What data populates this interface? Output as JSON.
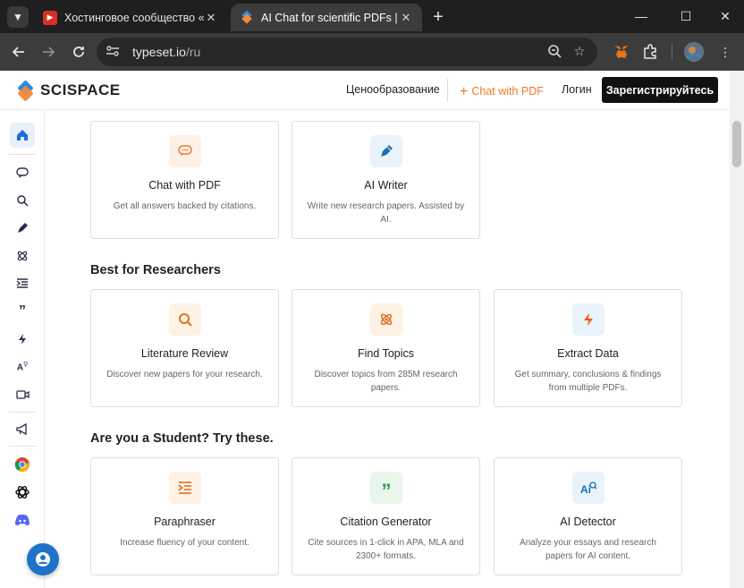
{
  "browser": {
    "tabs": [
      {
        "title": "Хостинговое сообщество «Tim",
        "favicon": "timeweb-favicon",
        "active": false
      },
      {
        "title": "AI Chat for scientific PDFs | SciS",
        "favicon": "scispace-favicon",
        "active": true
      }
    ],
    "url": {
      "host": "typeset.io",
      "path": "/ru"
    }
  },
  "site": {
    "logo_text": "SCISPACE",
    "nav": {
      "pricing": "Ценообразование",
      "chat_pdf": "Chat with PDF",
      "chat_pdf_icon": "+",
      "login": "Логин",
      "signup": "Зарегистрируйтесь"
    }
  },
  "sidebar": {
    "items": [
      {
        "name": "home-icon",
        "active": true
      },
      {
        "name": "chat-icon"
      },
      {
        "name": "search-doc-icon"
      },
      {
        "name": "pen-icon"
      },
      {
        "name": "atom-icon"
      },
      {
        "name": "indent-icon"
      },
      {
        "name": "quote-icon"
      },
      {
        "name": "bolt-icon"
      },
      {
        "name": "ai-detector-icon"
      },
      {
        "name": "video-icon"
      },
      {
        "name": "megaphone-icon"
      },
      {
        "name": "chrome-icon"
      },
      {
        "name": "openai-icon"
      },
      {
        "name": "discord-icon"
      }
    ]
  },
  "sections": [
    {
      "title": "",
      "cards": [
        {
          "title": "Chat with PDF",
          "desc": "Get all answers backed by citations.",
          "icon": "chat-icon",
          "icon_bg": "#fdf1e7",
          "icon_color": "#f07a2b"
        },
        {
          "title": "AI Writer",
          "desc": "Write new research papers. Assisted by AI.",
          "icon": "pen-icon",
          "icon_bg": "#eaf3fa",
          "icon_color": "#1a6fb0"
        }
      ]
    },
    {
      "title": "Best for Researchers",
      "cards": [
        {
          "title": "Literature Review",
          "desc": "Discover new papers for your research.",
          "icon": "search-icon",
          "icon_bg": "#fdf2e4",
          "icon_color": "#d9761e"
        },
        {
          "title": "Find Topics",
          "desc": "Discover topics from 285M research papers.",
          "icon": "atom-icon",
          "icon_bg": "#fdf2e4",
          "icon_color": "#e0681f"
        },
        {
          "title": "Extract Data",
          "desc": "Get summary, conclusions & findings from multiple PDFs.",
          "icon": "bolt-icon",
          "icon_bg": "#eaf3fa",
          "icon_color": "#f05a1a"
        }
      ]
    },
    {
      "title": "Are you a Student? Try these.",
      "cards": [
        {
          "title": "Paraphraser",
          "desc": "Increase fluency of your content.",
          "icon": "indent-icon",
          "icon_bg": "#fdf2e4",
          "icon_color": "#e0681f"
        },
        {
          "title": "Citation Generator",
          "desc": "Cite sources in 1-click in APA, MLA and 2300+ formats.",
          "icon": "quote-icon",
          "icon_bg": "#e8f6ec",
          "icon_color": "#2e9e4f"
        },
        {
          "title": "AI Detector",
          "desc": "Analyze your essays and research papers for AI content.",
          "icon": "ai-detector-icon",
          "icon_bg": "#eaf3fa",
          "icon_color": "#1a6fb0"
        }
      ]
    }
  ]
}
